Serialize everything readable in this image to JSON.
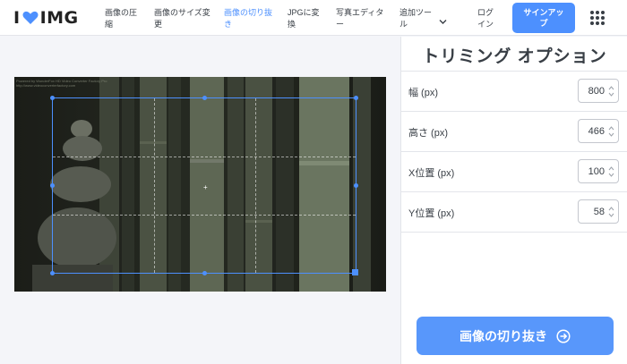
{
  "header": {
    "logo_left": "I",
    "logo_right": "IMG",
    "nav": [
      {
        "label_1": "画像の圧",
        "label_2": "縮"
      },
      {
        "label_1": "画像のサイズ変",
        "label_2": "更"
      },
      {
        "label_1": "画像の切り抜",
        "label_2": "き"
      },
      {
        "label_1": "JPGに変",
        "label_2": "換"
      },
      {
        "label_1": "写真エディタ",
        "label_2": "ー"
      },
      {
        "label_1": "追加ツー",
        "label_2": "ル"
      }
    ],
    "login_1": "ログ",
    "login_2": "イン",
    "signup_1": "サインアッ",
    "signup_2": "プ"
  },
  "image": {
    "watermark_1": "Powered by WonderFox HD Video Converter Factory Pro",
    "watermark_2": "http://www.videoconverterfactory.com"
  },
  "sidebar": {
    "title": "トリミング オプション",
    "fields": [
      {
        "label": "幅 (px)",
        "value": "800"
      },
      {
        "label": "高さ (px)",
        "value": "466"
      },
      {
        "label": "X位置 (px)",
        "value": "100"
      },
      {
        "label": "Y位置 (px)",
        "value": "58"
      }
    ],
    "crop_button": "画像の切り抜き"
  },
  "colors": {
    "accent": "#4d90fe",
    "text": "#383e45",
    "background": "#f4f5f9"
  },
  "icons": {
    "logo_heart": "heart-icon",
    "nav_more": "chevron-down-icon",
    "apps": "grid-dots-icon",
    "spinner": "up-down-arrows-icon",
    "crop_button": "arrow-right-circle-icon"
  }
}
